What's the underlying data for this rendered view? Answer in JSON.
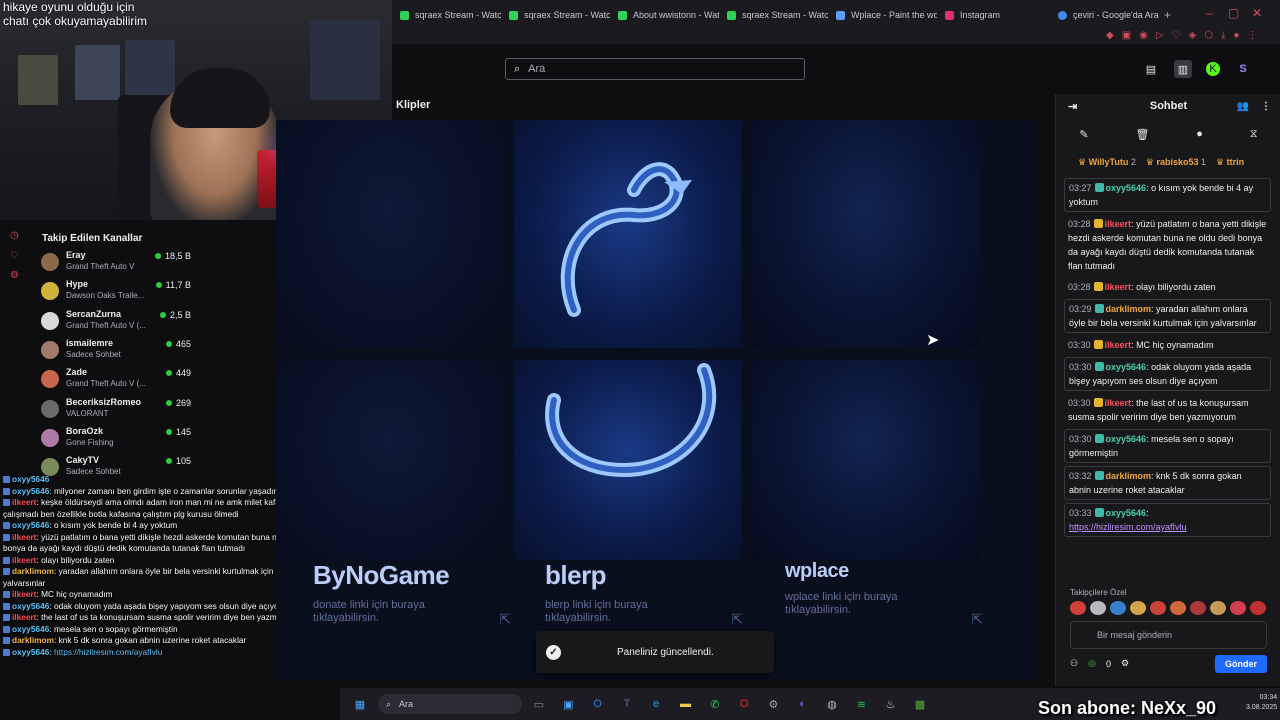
{
  "browser": {
    "tabs": [
      {
        "title": "sqraex Stream - Watc",
        "color": "#30d158"
      },
      {
        "title": "sqraex Stream - Watc",
        "color": "#30d158"
      },
      {
        "title": "About wwistonn - Wat",
        "color": "#30d158"
      },
      {
        "title": "sqraex Stream - Watc",
        "color": "#30d158"
      },
      {
        "title": "Wplace - Paint the wo",
        "color": "#5b9cff"
      },
      {
        "title": "Instagram",
        "color": "#e1306c"
      }
    ],
    "google_tab": "çeviri - Google'da Ara"
  },
  "twitch": {
    "search_placeholder": "Ara",
    "section_title": "Klipler"
  },
  "panels": {
    "sponsors": [
      {
        "name": "ByNoGame",
        "desc": "donate linki için buraya tıklayabilirsin."
      },
      {
        "name": "blerp",
        "desc": "blerp linki için buraya tıklayabilirsin."
      },
      {
        "name": "wplace",
        "desc": "wplace linki için buraya tıklayabilirsin."
      }
    ],
    "toast": "Paneliniz güncellendi."
  },
  "chat": {
    "title": "Sohbet",
    "leaders": [
      {
        "name": "WillyTutu",
        "count": "2"
      },
      {
        "name": "rabisko53",
        "count": "1"
      },
      {
        "name": "ttrin",
        "count": ""
      }
    ],
    "messages": [
      {
        "time": "03:27",
        "user": "oxyy5646",
        "color": "#46d0ad",
        "text": ": o kısım yok bende bi 4 ay yoktum",
        "boxed": true,
        "badge": "#3fb8a8"
      },
      {
        "time": "03:28",
        "user": "ilkeert",
        "color": "#ff4d5e",
        "text": ": yüzü patlatım o bana yetti dikişle hezdi askerde komutan buna ne oldu dedi bonya da ayağı kaydı düştü dedik komutanda tutanak flan tutmadı",
        "boxed": false,
        "badge": "#e6b32f"
      },
      {
        "time": "03:28",
        "user": "ilkeert",
        "color": "#ff4d5e",
        "text": ": olayı biliyordu zaten",
        "boxed": false,
        "badge": "#e6b32f"
      },
      {
        "time": "03:29",
        "user": "darklimom",
        "color": "#f0a63a",
        "text": ": yaradan allahım onlara öyle bir bela versinki kurtulmak için yalvarsınlar",
        "boxed": true,
        "badge": "#3fb8a8"
      },
      {
        "time": "03:30",
        "user": "ilkeert",
        "color": "#ff4d5e",
        "text": ": MC hiç oynamadım",
        "boxed": false,
        "badge": "#e6b32f"
      },
      {
        "time": "03:30",
        "user": "oxyy5646",
        "color": "#46d0ad",
        "text": ": odak oluyom yada aşada bişey yapıyom ses olsun diye açıyom",
        "boxed": true,
        "badge": "#3fb8a8"
      },
      {
        "time": "03:30",
        "user": "ilkeert",
        "color": "#ff4d5e",
        "text": ": the last of us ta konuşursam susma spolir veririm diye ben yazmıyorum",
        "boxed": false,
        "badge": "#e6b32f"
      },
      {
        "time": "03:30",
        "user": "oxyy5646",
        "color": "#46d0ad",
        "text": ": mesela sen o sopayı görmemiştin",
        "boxed": true,
        "badge": "#3fb8a8"
      },
      {
        "time": "03:32",
        "user": "darklimom",
        "color": "#f0a63a",
        "text": ": knk 5 dk sonra gokan abnin uzerine roket atacaklar",
        "boxed": true,
        "badge": "#3fb8a8"
      },
      {
        "time": "03:33",
        "user": "oxyy5646",
        "color": "#46d0ad",
        "text": ":",
        "link": "https://hizliresim.com/ayafIvlu",
        "boxed": true,
        "badge": "#3fb8a8"
      }
    ],
    "emote_label": "Takipçilere Özel",
    "input_placeholder": "Bir mesaj gönderin",
    "points": "0",
    "send_label": "Gönder"
  },
  "webcam": {
    "overlay_line1": "hikaye oyunu olduğu için",
    "overlay_line2": "chatı çok okuyamayabilirim"
  },
  "followed": {
    "title": "Takip Edilen Kanallar",
    "channels": [
      {
        "name": "Eray",
        "game": "Grand Theft Auto V",
        "viewers": "18,5 B",
        "color": "#8a6a4a"
      },
      {
        "name": "Hype",
        "game": "Dawson Oaks Traile...",
        "viewers": "11,7 B",
        "color": "#d0b43a"
      },
      {
        "name": "SercanZurna",
        "game": "Grand Theft Auto V (...",
        "viewers": "2,5 B",
        "color": "#d8d8d8"
      },
      {
        "name": "ismailemre",
        "game": "Sadece Sohbet",
        "viewers": "465",
        "color": "#a47a6a"
      },
      {
        "name": "Zade",
        "game": "Grand Theft Auto V (...",
        "viewers": "449",
        "color": "#c7664a"
      },
      {
        "name": "BeceriksizRomeo",
        "game": "VALORANT",
        "viewers": "269",
        "color": "#6a6a6a"
      },
      {
        "name": "BoraOzk",
        "game": "Gone Fishing",
        "viewers": "145",
        "color": "#b07aa6"
      },
      {
        "name": "CakyTV",
        "game": "Sadece Sohbet",
        "viewers": "105",
        "color": "#7a8a5a"
      }
    ]
  },
  "overlay_chat": [
    {
      "user": "oxyy5646",
      "cls": "blue",
      "text": ""
    },
    {
      "user": "oxyy5646",
      "cls": "blue",
      "text": ": milyoner zamanı ben girdim işte o zamanlar sorunlar yaşadım"
    },
    {
      "user": "ilkeert",
      "cls": "red",
      "text": ": keşke öldürseydi ama olmdı adam iron man mi ne amk milet kafaya"
    },
    {
      "user": "",
      "cls": "",
      "text": "çalışmadı ben özellikle botla kafasına çalıştım plg kurusu ölmedi"
    },
    {
      "user": "oxyy5646",
      "cls": "blue",
      "text": ": o kısım yok bende bi 4 ay yoktum"
    },
    {
      "user": "ilkeert",
      "cls": "red",
      "text": ": yüzü patlatım o bana yetti dikişle hezdi askerde komutan buna ne oldu dedi"
    },
    {
      "user": "",
      "cls": "",
      "text": "bonya da ayağı kaydı düştü dedik komutanda tutanak flan tutmadı"
    },
    {
      "user": "ilkeert",
      "cls": "red",
      "text": ": olayı biliyordu zaten"
    },
    {
      "user": "darklimom",
      "cls": "gold",
      "text": ": yaradan allahım onlara öyle bir bela versinki kurtulmak için"
    },
    {
      "user": "",
      "cls": "",
      "text": "yalvarsınlar"
    },
    {
      "user": "ilkeert",
      "cls": "red",
      "text": ": MC hiç oynamadım"
    },
    {
      "user": "oxyy5646",
      "cls": "blue",
      "text": ": odak oluyom yada aşada bişey yapıyom ses olsun diye açıyom"
    },
    {
      "user": "ilkeert",
      "cls": "red",
      "text": ": the last of us ta konuşursam susma spolir veririm diye ben yazmıyorum"
    },
    {
      "user": "oxyy5646",
      "cls": "blue",
      "text": ": mesela sen o sopayı görmemiştin"
    },
    {
      "user": "darklimom",
      "cls": "gold",
      "text": ": knk 5 dk sonra gokan abnin uzerine roket atacaklar"
    },
    {
      "user": "oxyy5646",
      "cls": "blue",
      "text": ":",
      "link": "https://hizliresim.com/ayafIvlu"
    }
  ],
  "taskbar": {
    "search_placeholder": "Ara",
    "time": "03:34",
    "date": "3.08.2025"
  },
  "sub_banner": "Son abone: NeXx_90"
}
